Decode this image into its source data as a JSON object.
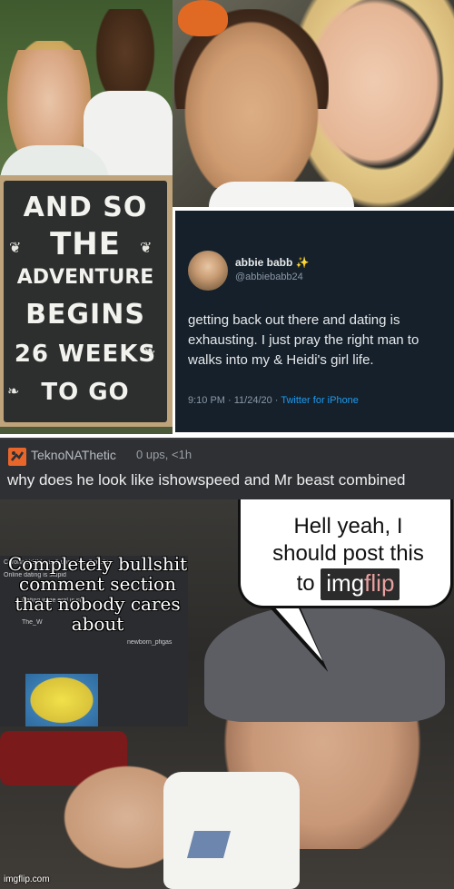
{
  "chalkboard": {
    "lines": [
      "AND SO",
      "THE",
      "ADVENTURE",
      "BEGINS",
      "26 WEEKS",
      "TO GO"
    ]
  },
  "tweet": {
    "name": "abbie babb",
    "sparkle": "✨",
    "handle": "@abbiebabb24",
    "body_lines": [
      "getting back out there and dating is",
      "exhausting. I just pray the right man to",
      "walks into my & Heidi's girl life."
    ],
    "timestamp": "9:10 PM · 11/24/20 ·",
    "source": "Twitter for iPhone"
  },
  "comment": {
    "username": "TeknoNAThetic",
    "meta": "0 ups, <1h",
    "text": "why does he look like ishowspeed and Mr beast combined"
  },
  "meme": {
    "speech_line1": "Hell yeah, I",
    "speech_line2": "should post this",
    "speech_to": "to",
    "speech_brand_a": "img",
    "speech_brand_b": "flip",
    "overlay_text": "Completely bullshit comment section that nobody cares about",
    "mini_rows": [
      "ChronicUrlifMusic 3 ups, <1h, 3 replies",
      "Online dating is stupid",
      "Dating in ge  eral is st",
      "The_W",
      "newborn_pfigas"
    ]
  },
  "watermark": "imgflip.com",
  "colors": {
    "tweet_bg": "#15202b",
    "comment_bg": "#2e3034",
    "imgflip_orange": "#e9662b",
    "twitter_blue": "#1d9bf0"
  },
  "icons": {
    "comment_avatar": "imgflip-logo-icon"
  }
}
